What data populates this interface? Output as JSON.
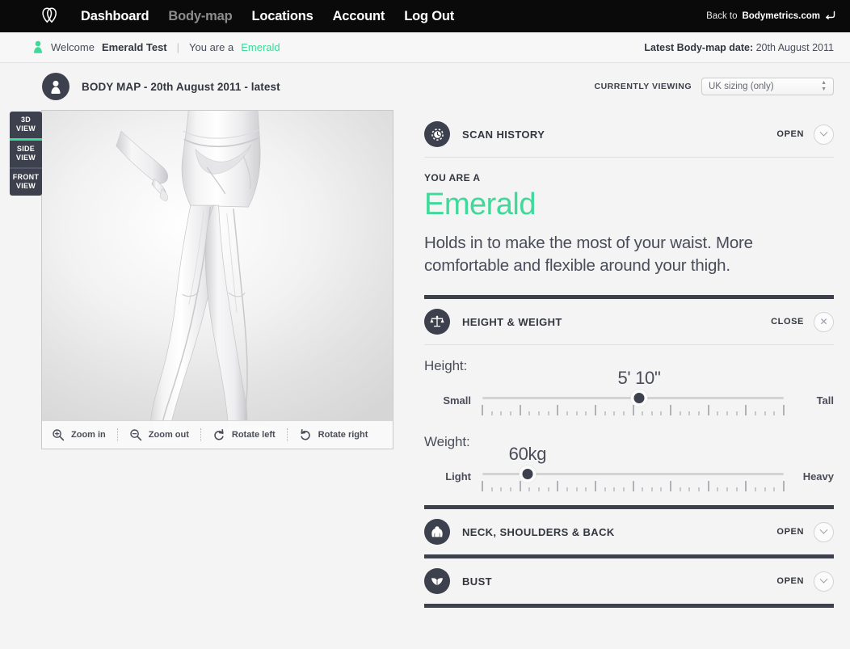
{
  "brand": {
    "logo_icon": "bodymetrics-heart-logo",
    "accent_color": "#3fd99a",
    "dark_color": "#3d404d"
  },
  "topnav": {
    "links": [
      {
        "label": "Dashboard",
        "active": false
      },
      {
        "label": "Body-map",
        "active": true
      },
      {
        "label": "Locations",
        "active": false
      },
      {
        "label": "Account",
        "active": false
      },
      {
        "label": "Log Out",
        "active": false
      }
    ],
    "back_link": {
      "prefix": "Back to ",
      "site": "Bodymetrics.com",
      "icon": "return-arrow-icon"
    }
  },
  "welcome_bar": {
    "icon": "person-green-icon",
    "greeting": "Welcome ",
    "user_name": "Emerald Test",
    "separator": "|",
    "you_are_prefix": "You are a ",
    "body_type": "Emerald",
    "latest_label": "Latest Body-map date:",
    "latest_date": "20th August 2011"
  },
  "bodymap_header": {
    "icon": "person-avatar-icon",
    "title": "BODY MAP - 20th August 2011 - latest",
    "viewing_label": "CURRENTLY VIEWING",
    "sizing_selected": "UK sizing (only)",
    "sizing_options": [
      "UK sizing (only)"
    ]
  },
  "viewer": {
    "tabs": [
      {
        "line1": "3D",
        "line2": "VIEW",
        "active": false
      },
      {
        "line1": "SIDE",
        "line2": "VIEW",
        "active": true
      },
      {
        "line1": "FRONT",
        "line2": "VIEW",
        "active": false
      }
    ],
    "tools": [
      {
        "label": "Zoom in",
        "icon": "zoom-in-icon"
      },
      {
        "label": "Zoom out",
        "icon": "zoom-out-icon"
      },
      {
        "label": "Rotate left",
        "icon": "rotate-left-icon"
      },
      {
        "label": "Rotate right",
        "icon": "rotate-right-icon"
      }
    ]
  },
  "panel": {
    "scan_history": {
      "icon": "scan-history-clock-icon",
      "title": "SCAN HISTORY",
      "action_label": "OPEN",
      "action_icon": "chevron-down-icon"
    },
    "body_type": {
      "eyebrow": "YOU ARE A",
      "name": "Emerald",
      "description": "Holds in to make the most of your waist. More comfortable and flexible around your thigh."
    },
    "height_weight": {
      "icon": "scales-icon",
      "title": "HEIGHT & WEIGHT",
      "action_label": "CLOSE",
      "action_icon": "close-x-icon",
      "height": {
        "label": "Height:",
        "min_label": "Small",
        "max_label": "Tall",
        "value": "5' 10\"",
        "position_percent": 52
      },
      "weight": {
        "label": "Weight:",
        "min_label": "Light",
        "max_label": "Heavy",
        "value": "60kg",
        "position_percent": 15
      }
    },
    "sections": [
      {
        "icon": "neck-shoulders-back-icon",
        "title": "NECK, SHOULDERS & BACK",
        "action_label": "OPEN",
        "action_icon": "chevron-down-icon"
      },
      {
        "icon": "bust-icon",
        "title": "BUST",
        "action_label": "OPEN",
        "action_icon": "chevron-down-icon"
      }
    ]
  }
}
